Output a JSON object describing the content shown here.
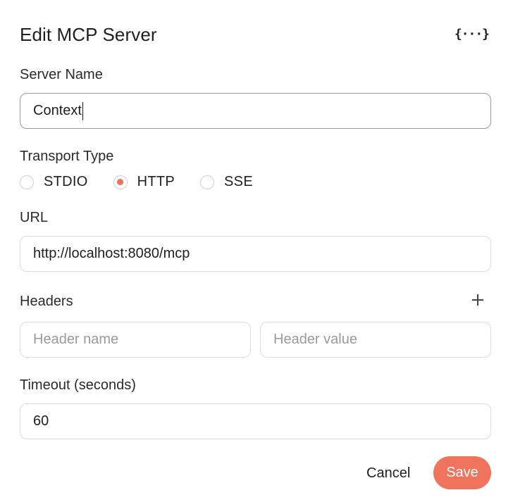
{
  "dialog": {
    "title": "Edit MCP Server",
    "json_toggle_glyph": "{···}"
  },
  "server_name": {
    "label": "Server Name",
    "value": "Context"
  },
  "transport": {
    "label": "Transport Type",
    "options": [
      {
        "label": "STDIO",
        "selected": false
      },
      {
        "label": "HTTP",
        "selected": true
      },
      {
        "label": "SSE",
        "selected": false
      }
    ]
  },
  "url": {
    "label": "URL",
    "value": "http://localhost:8080/mcp"
  },
  "headers": {
    "label": "Headers",
    "name_placeholder": "Header name",
    "value_placeholder": "Header value",
    "add_icon": "plus-icon"
  },
  "timeout": {
    "label": "Timeout (seconds)",
    "value": "60"
  },
  "actions": {
    "cancel_label": "Cancel",
    "save_label": "Save"
  },
  "colors": {
    "accent": "#f0735d",
    "border": "#dcdcdc",
    "placeholder": "#9a9a9a"
  }
}
